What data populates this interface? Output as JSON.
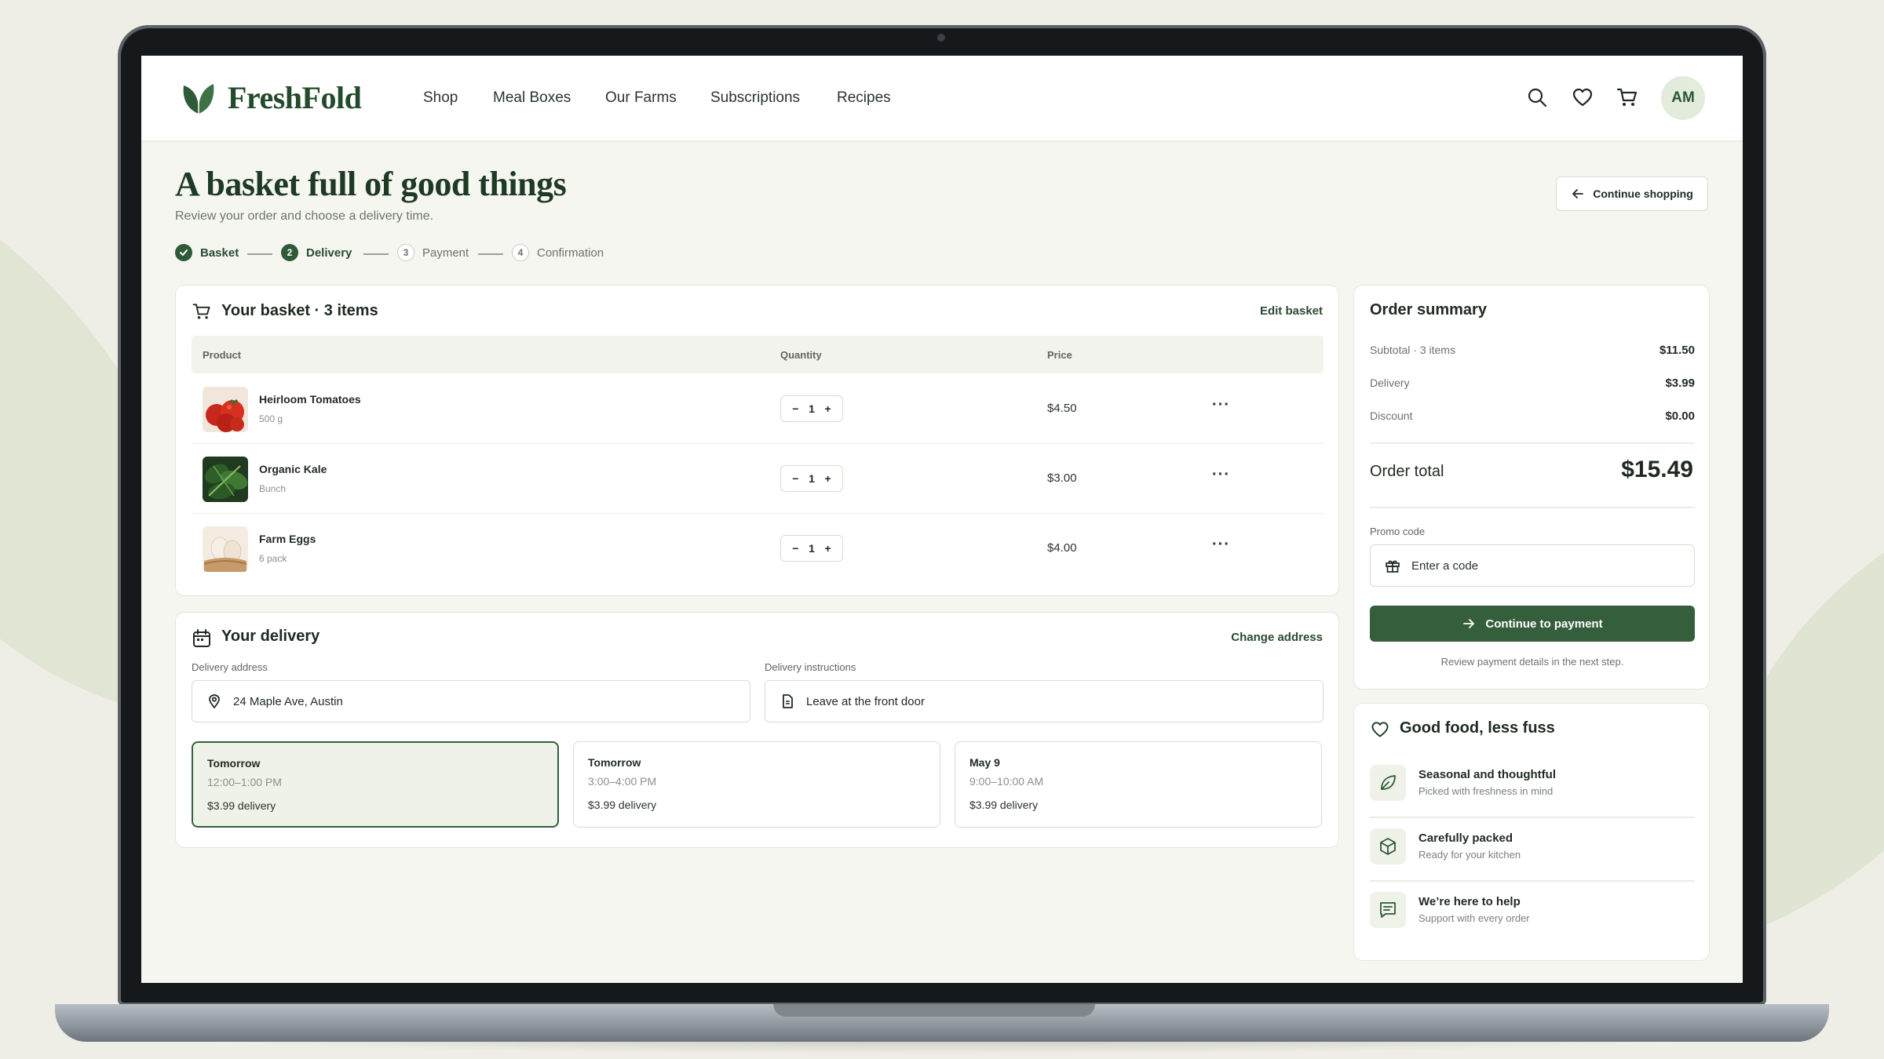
{
  "brand": {
    "name": "FreshFold",
    "accent": "#355e3c"
  },
  "nav": {
    "links": [
      "Shop",
      "Meal Boxes",
      "Our Farms",
      "Subscriptions",
      "Recipes"
    ],
    "icons": [
      "search-icon",
      "heart-icon",
      "cart-icon"
    ],
    "avatar_initials": "AM"
  },
  "header": {
    "title": "A basket full of good things",
    "subtitle": "Review your order and choose a delivery time.",
    "continue_label": "Continue shopping"
  },
  "stepper": {
    "steps": [
      {
        "num": "",
        "label": "Basket",
        "state": "done"
      },
      {
        "num": "2",
        "label": "Delivery",
        "state": "active"
      },
      {
        "num": "3",
        "label": "Payment",
        "state": "todo"
      },
      {
        "num": "4",
        "label": "Confirmation",
        "state": "todo"
      }
    ]
  },
  "basket": {
    "title": "Your basket · 3 items",
    "edit_label": "Edit basket",
    "columns": [
      "Product",
      "Quantity",
      "Price"
    ],
    "items": [
      {
        "name": "Heirloom Tomatoes",
        "detail": "500 g",
        "qty": "1",
        "price": "$4.50"
      },
      {
        "name": "Organic Kale",
        "detail": "Bunch",
        "qty": "1",
        "price": "$3.00"
      },
      {
        "name": "Farm Eggs",
        "detail": "6 pack",
        "qty": "1",
        "price": "$4.00"
      }
    ],
    "qty_minus": "−",
    "qty_plus": "+",
    "more": "···"
  },
  "delivery": {
    "title": "Your delivery",
    "change_label": "Change address",
    "address_label": "Delivery address",
    "address_value": "24 Maple Ave, Austin",
    "instructions_label": "Delivery instructions",
    "instructions_value": "Leave at the front door",
    "slots": [
      {
        "day": "Tomorrow",
        "time": "12:00–1:00 PM",
        "fee": "$3.99 delivery",
        "selected": true
      },
      {
        "day": "Tomorrow",
        "time": "3:00–4:00 PM",
        "fee": "$3.99 delivery",
        "selected": false
      },
      {
        "day": "May 9",
        "time": "9:00–10:00 AM",
        "fee": "$3.99 delivery",
        "selected": false
      }
    ]
  },
  "summary": {
    "title": "Order summary",
    "rows": [
      {
        "label": "Subtotal · 3 items",
        "value": "$11.50"
      },
      {
        "label": "Delivery",
        "value": "$3.99"
      },
      {
        "label": "Discount",
        "value": "$0.00"
      }
    ],
    "total_label": "Order total",
    "total_value": "$15.49",
    "promo_label": "Promo code",
    "promo_placeholder": "Enter a code",
    "pay_label": "Continue to payment",
    "note": "Review payment details in the next step."
  },
  "features": {
    "title": "Good food, less fuss",
    "items": [
      {
        "title": "Seasonal and thoughtful",
        "sub": "Picked with freshness in mind",
        "icon": "leaf-icon"
      },
      {
        "title": "Carefully packed",
        "sub": "Ready for your kitchen",
        "icon": "box-icon"
      },
      {
        "title": "We’re here to help",
        "sub": "Support with every order",
        "icon": "chat-icon"
      }
    ]
  }
}
